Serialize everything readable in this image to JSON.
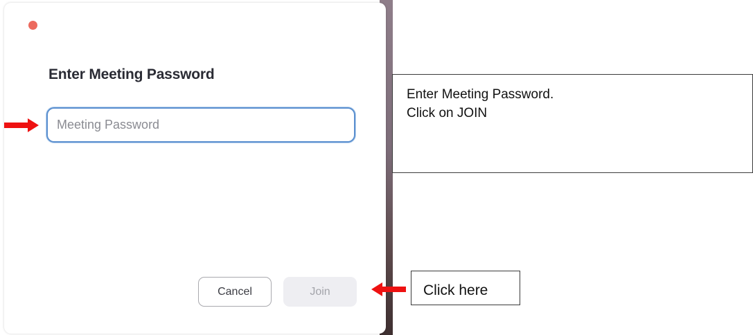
{
  "dialog": {
    "title": "Enter Meeting Password",
    "password_field": {
      "value": "",
      "placeholder": "Meeting Password"
    },
    "cancel_label": "Cancel",
    "join_label": "Join"
  },
  "annotations": {
    "instructions": {
      "line1": "Enter Meeting Password.",
      "line2": "Click on JOIN"
    },
    "click_here": "Click here"
  },
  "icons": {
    "close": "close-icon",
    "arrow_to_field": "right-arrow-icon",
    "arrow_to_join": "left-arrow-icon"
  },
  "colors": {
    "close_dot": "#ec6a5e",
    "input_focus_border": "#5a8fcf",
    "arrow": "#ee1111",
    "join_disabled_bg": "#eeeef2",
    "join_disabled_text": "#a3a4aa"
  }
}
